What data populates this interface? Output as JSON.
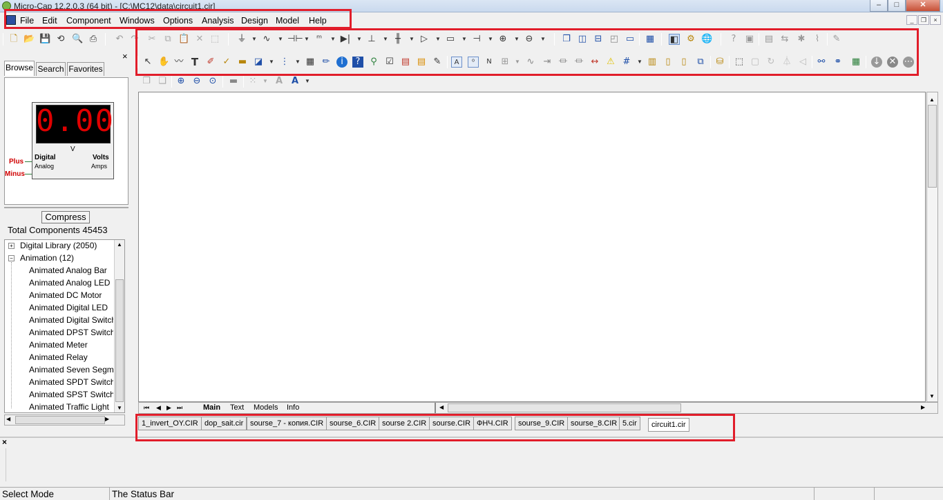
{
  "window": {
    "title": "Micro-Cap 12.2.0.3 (64 bit) - [C:\\MC12\\data\\circuit1.cir]",
    "minimize": "–",
    "maximize": "□",
    "close": "✕"
  },
  "menu": {
    "items": [
      "File",
      "Edit",
      "Component",
      "Windows",
      "Options",
      "Analysis",
      "Design",
      "Model",
      "Help"
    ]
  },
  "left_panel": {
    "close": "×",
    "tabs": [
      "Browse",
      "Search",
      "Favorites"
    ],
    "active_tab": "Browse",
    "preview": {
      "display_value": "0.00",
      "unit": "V",
      "label_digital": "Digital",
      "label_analog": "Analog",
      "label_volts": "Volts",
      "label_amps": "Amps",
      "pin_plus": "Plus",
      "pin_minus": "Minus"
    },
    "compress_button": "Compress",
    "total_components": "Total Components 45453",
    "tree": {
      "groups": [
        {
          "label": "Digital Library (2050)",
          "expanded": false,
          "toggle": "+"
        },
        {
          "label": "Animation (12)",
          "expanded": true,
          "toggle": "−"
        }
      ],
      "items": [
        "Animated Analog Bar",
        "Animated Analog LED",
        "Animated DC Motor",
        "Animated Digital LED",
        "Animated Digital Switch",
        "Animated DPST Switch",
        "Animated Meter",
        "Animated Relay",
        "Animated Seven Segment",
        "Animated SPDT Switch",
        "Animated SPST Switch",
        "Animated Traffic Light"
      ]
    }
  },
  "sheet_tabs": [
    "Main",
    "Text",
    "Models",
    "Info"
  ],
  "file_tabs": [
    "1_invert_OY.CIR",
    "dop_sait.cir",
    "sourse_7 - копия.CIR",
    "sourse_6.CIR",
    "sourse 2.CIR",
    "sourse.CIR",
    "ФНЧ.CIR",
    "sourse_9.CIR",
    "sourse_8.CIR",
    "5.cir",
    "circuit1.cir"
  ],
  "active_file_tab": "circuit1.cir",
  "output_close": "×",
  "status": {
    "mode": "Select Mode",
    "message": "The Status Bar"
  },
  "toolbar_icons": {
    "row1_left": [
      "new-file-icon",
      "open-folder-icon",
      "save-icon",
      "revert-icon",
      "print-preview-icon",
      "print-icon",
      "undo-icon",
      "redo-icon"
    ],
    "row1_right": [
      "cut-icon",
      "copy-icon",
      "paste-icon",
      "delete-icon",
      "select-all-icon",
      "ground-icon",
      "resistor-icon",
      "capacitor-icon",
      "inductor-icon",
      "diode-icon",
      "bjt-icon",
      "mosfet-icon",
      "opamp-icon",
      "component-icon",
      "battery-icon",
      "voltage-source-icon",
      "current-source-icon",
      "cascade-icon",
      "tile-vertical-icon",
      "tile-horizontal-icon",
      "restore-icon",
      "maximize-icon",
      "calculator-icon",
      "component-panel-icon",
      "properties-icon",
      "globe-icon",
      "help-icon",
      "tools-icon",
      "options-icon",
      "analysis-icon",
      "design-icon",
      "chart-icon",
      "model-icon"
    ],
    "row2": [
      "select-arrow-icon",
      "pan-hand-icon",
      "wire-icon",
      "text-icon",
      "pen-icon",
      "flag-icon",
      "bus-icon",
      "shapes-icon",
      "hierarchy-icon",
      "table-icon",
      "pencil-icon",
      "info-icon",
      "help-icon",
      "library-icon",
      "checkbox-icon",
      "report-icon",
      "grid-icon",
      "edit-icon",
      "attribute-text-icon",
      "node-numbers-icon",
      "node-names-icon",
      "pin-connections-icon",
      "node-voltage-icon",
      "current-icon",
      "power-icon",
      "condition-icon",
      "warning-icon",
      "grid-dots-icon",
      "page-icon",
      "page-border-icon",
      "page-title-icon",
      "link-icon",
      "find-icon",
      "rotate-icon",
      "flip-x-icon",
      "flip-y-icon",
      "mirror-icon",
      "zoom-find-icon",
      "binoculars-icon",
      "spreadsheet-icon",
      "stop-icon",
      "close-circle-icon",
      "more-icon"
    ],
    "row3": [
      "bring-front-icon",
      "send-back-icon",
      "zoom-in-icon",
      "zoom-out-icon",
      "zoom-fit-icon",
      "font-icon",
      "align-icon",
      "font-size-icon",
      "font-color-icon"
    ]
  }
}
